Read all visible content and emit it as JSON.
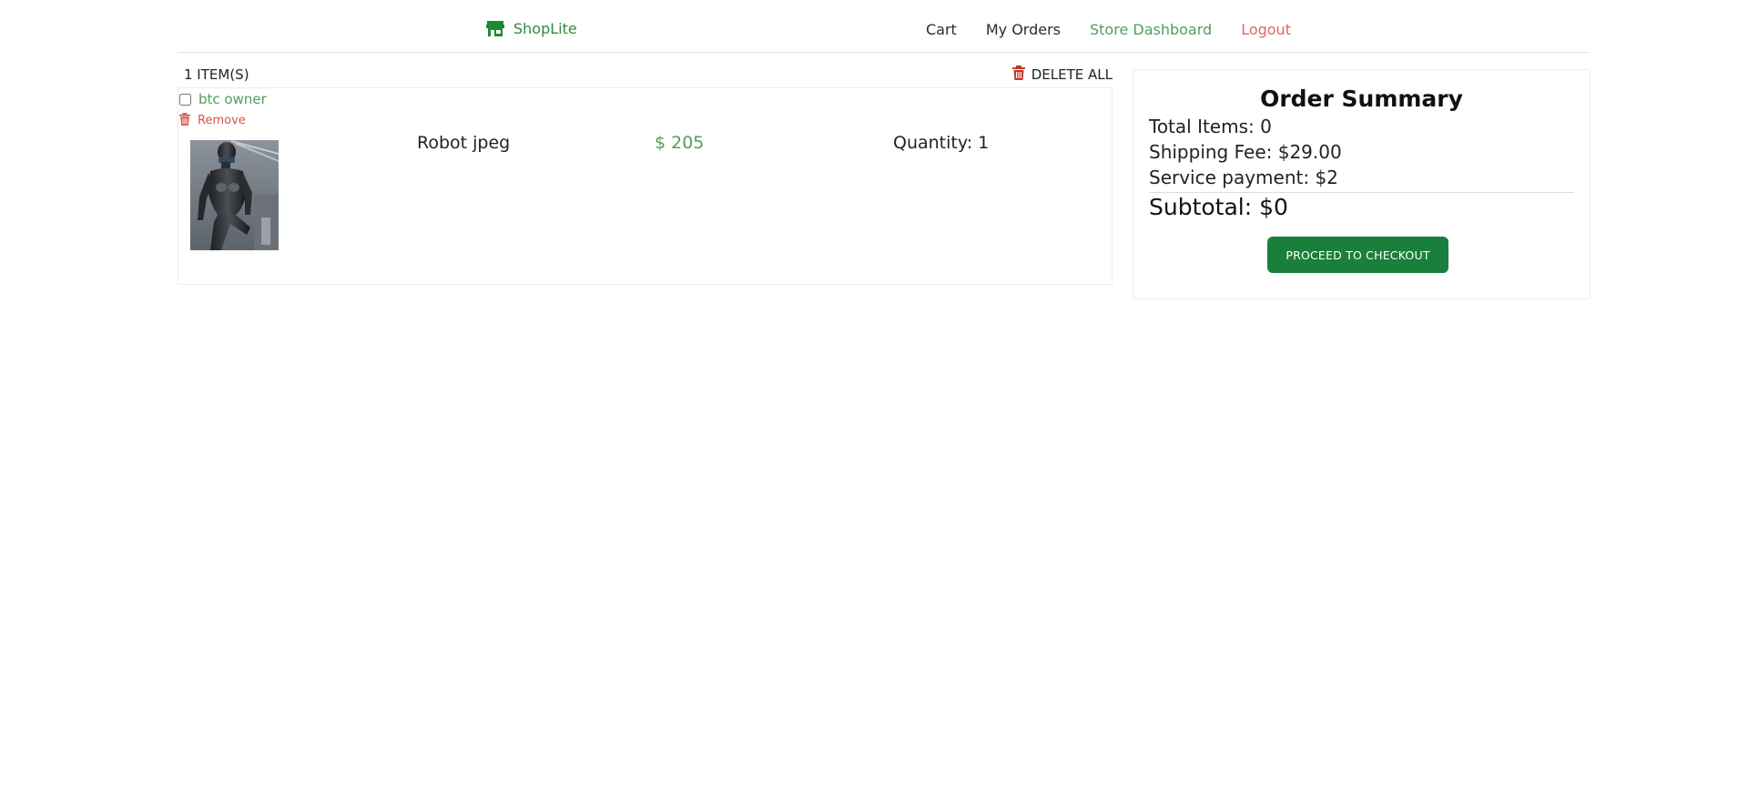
{
  "navbar": {
    "brand": "ShopLite",
    "links": {
      "cart": "Cart",
      "orders": "My Orders",
      "dashboard": "Store Dashboard",
      "logout": "Logout"
    },
    "colors": {
      "brand": "#2e8b3e",
      "dashboard": "#4f9f5b",
      "logout": "#e06666"
    }
  },
  "cart": {
    "item_count": "1 ITEM(S)",
    "delete_all": "DELETE ALL",
    "store": {
      "name": "btc owner",
      "checked": false,
      "remove_label": "Remove"
    },
    "items": [
      {
        "name": "Robot jpeg",
        "price": "$ 205",
        "quantity": "Quantity: 1",
        "image": "robot-figure"
      }
    ]
  },
  "summary": {
    "title": "Order Summary",
    "total_items": "Total Items: 0",
    "shipping_fee": "Shipping Fee: $29.00",
    "service_payment": "Service payment: $2",
    "subtotal": "Subtotal: $0",
    "checkout_button": "PROCEED TO CHECKOUT",
    "button_color": "#1a7f3c"
  },
  "icons": {
    "brand": "store-icon",
    "delete_all": "trash-icon",
    "remove": "trash-icon"
  }
}
